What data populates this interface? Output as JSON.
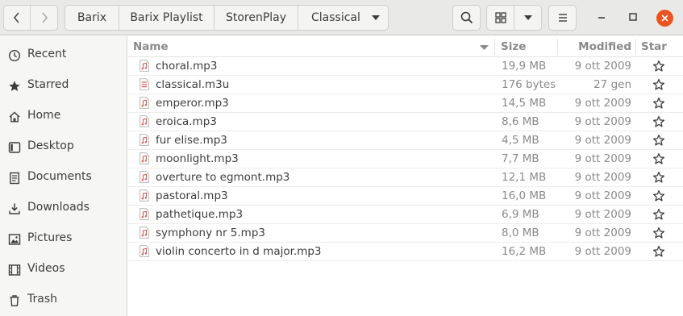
{
  "header": {
    "breadcrumbs": [
      "Barix",
      "Barix Playlist",
      "StorenPlay",
      "Classical"
    ]
  },
  "sidebar": {
    "items": [
      {
        "label": "Recent",
        "icon": "clock-icon"
      },
      {
        "label": "Starred",
        "icon": "star-icon"
      },
      {
        "label": "Home",
        "icon": "home-icon"
      },
      {
        "label": "Desktop",
        "icon": "desktop-icon"
      },
      {
        "label": "Documents",
        "icon": "document-icon"
      },
      {
        "label": "Downloads",
        "icon": "download-icon"
      },
      {
        "label": "Pictures",
        "icon": "picture-icon"
      },
      {
        "label": "Videos",
        "icon": "video-icon"
      },
      {
        "label": "Trash",
        "icon": "trash-icon"
      }
    ]
  },
  "list": {
    "columns": {
      "name": "Name",
      "size": "Size",
      "modified": "Modified",
      "star": "Star"
    },
    "rows": [
      {
        "name": "choral.mp3",
        "size": "19,9 MB",
        "modified": "9 ott 2009",
        "type": "audio"
      },
      {
        "name": "classical.m3u",
        "size": "176 bytes",
        "modified": "27 gen",
        "type": "playlist"
      },
      {
        "name": "emperor.mp3",
        "size": "14,5 MB",
        "modified": "9 ott 2009",
        "type": "audio"
      },
      {
        "name": "eroica.mp3",
        "size": "8,6 MB",
        "modified": "9 ott 2009",
        "type": "audio"
      },
      {
        "name": "fur elise.mp3",
        "size": "4,5 MB",
        "modified": "9 ott 2009",
        "type": "audio"
      },
      {
        "name": "moonlight.mp3",
        "size": "7,7 MB",
        "modified": "9 ott 2009",
        "type": "audio"
      },
      {
        "name": "overture to egmont.mp3",
        "size": "12,1 MB",
        "modified": "9 ott 2009",
        "type": "audio"
      },
      {
        "name": "pastoral.mp3",
        "size": "16,0 MB",
        "modified": "9 ott 2009",
        "type": "audio"
      },
      {
        "name": "pathetique.mp3",
        "size": "6,9 MB",
        "modified": "9 ott 2009",
        "type": "audio"
      },
      {
        "name": "symphony nr 5.mp3",
        "size": "8,0 MB",
        "modified": "9 ott 2009",
        "type": "audio"
      },
      {
        "name": "violin concerto in d major.mp3",
        "size": "16,2 MB",
        "modified": "9 ott 2009",
        "type": "audio"
      }
    ]
  },
  "colors": {
    "headerbar": "#e9e9e7",
    "sidebar": "#f6f6f5",
    "close_button": "#e95420",
    "file_icon_accent": "#d45a5a"
  }
}
